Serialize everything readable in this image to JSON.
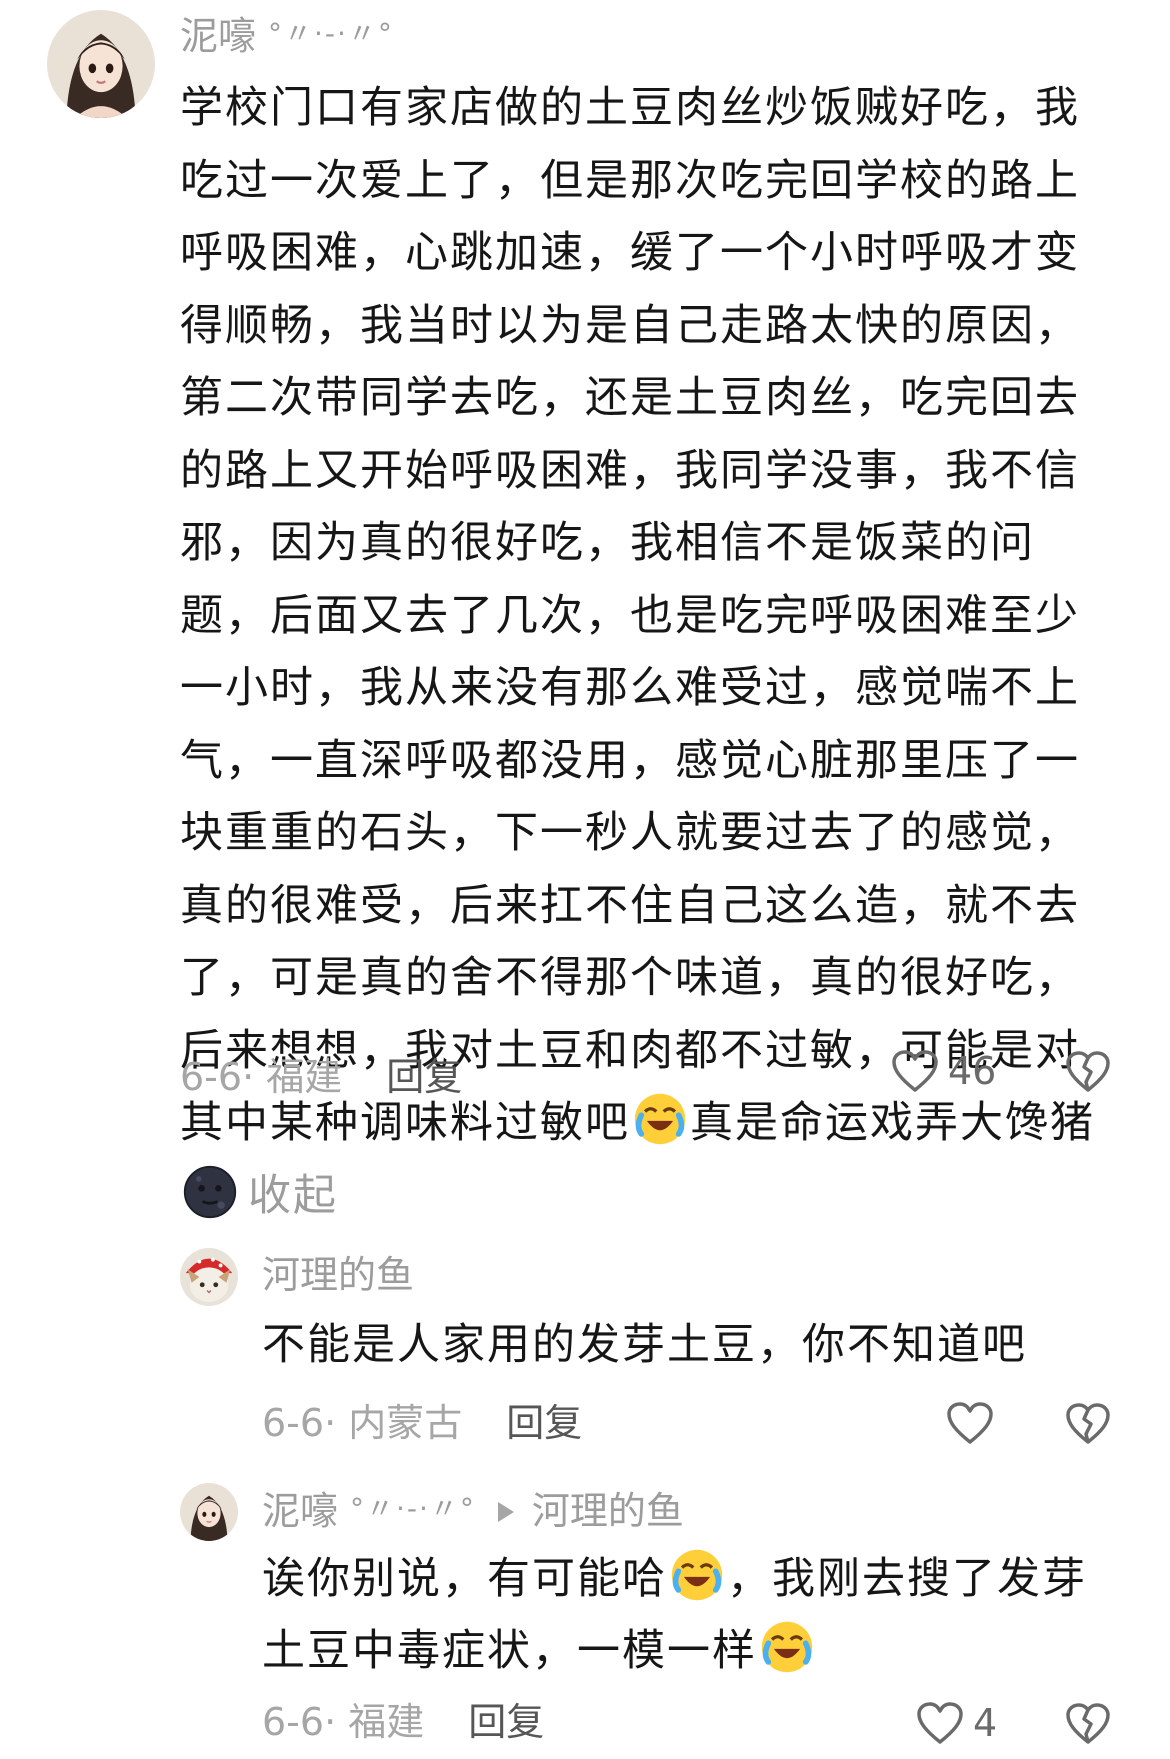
{
  "comment": {
    "username": "泥嚎",
    "username_deco": "°〃·-·〃°",
    "text_before_emoji1": "学校门口有家店做的土豆肉丝炒饭贼好吃，我吃过一次爱上了，但是那次吃完回学校的路上呼吸困难，心跳加速，缓了一个小时呼吸才变得顺畅，我当时以为是自己走路太快的原因，第二次带同学去吃，还是土豆肉丝，吃完回去的路上又开始呼吸困难，我同学没事，我不信邪，因为真的很好吃，我相信不是饭菜的问题，后面又去了几次，也是吃完呼吸困难至少一小时，我从来没有那么难受过，感觉喘不上气，一直深呼吸都没用，感觉心脏那里压了一块重重的石头，下一秒人就要过去了的感觉，真的很难受，后来扛不住自己这么造，就不去了，可是真的舍不得那个味道，真的很好吃，后来想想，我对土豆和肉都不过敏，可能是对其中某种调味料过敏吧",
    "text_after_emoji1": "真是命运戏弄大馋猪",
    "emoji1": "crying-laughing-emoji",
    "emoji2": "dark-moon-face-emoji",
    "collapse_label": "收起",
    "date": "6-6",
    "location": "福建",
    "reply_label": "回复",
    "like_count": "46"
  },
  "replies": [
    {
      "username": "河理的鱼",
      "text": "不能是人家用的发芽土豆，你不知道吧",
      "date": "6-6",
      "location": "内蒙古",
      "reply_label": "回复",
      "like_count": ""
    },
    {
      "username": "泥嚎",
      "username_deco": "°〃·-·〃°",
      "reply_to": "河理的鱼",
      "text_part1": "诶你别说，有可能哈",
      "text_part2": "，我刚去搜了发芽土豆中毒症状，一模一样",
      "emoji": "crying-laughing-emoji",
      "date": "6-6",
      "location": "福建",
      "reply_label": "回复",
      "like_count": "4"
    }
  ],
  "colors": {
    "text": "#161616",
    "muted": "#9c9c9c",
    "icon": "#6a6a6a"
  }
}
